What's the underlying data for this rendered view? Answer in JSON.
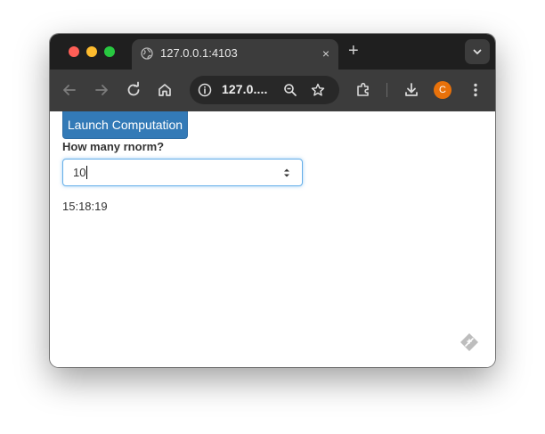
{
  "browser": {
    "tab_title": "127.0.0.1:4103",
    "tab_close": "×",
    "new_tab": "+",
    "url": "127.0....",
    "profile_initial": "C",
    "profile_color": "#e8710a"
  },
  "page": {
    "launch_label": "Launch Computation",
    "input_label": "How many rnorm?",
    "input_value": "10",
    "time_output": "15:18:19"
  },
  "icons": [
    "globe-icon",
    "close-icon",
    "plus-icon",
    "chevron-down-icon",
    "back-arrow-icon",
    "forward-arrow-icon",
    "reload-icon",
    "home-icon",
    "info-icon",
    "zoom-icon",
    "star-icon",
    "extensions-icon",
    "download-icon",
    "kebab-menu-icon",
    "stepper-icon",
    "feather-icon"
  ],
  "colors": {
    "button_primary": "#337ab7",
    "input_focus": "#66afe9",
    "tabbar_bg": "#1f1f1f",
    "toolbar_bg": "#3c3c3c"
  }
}
